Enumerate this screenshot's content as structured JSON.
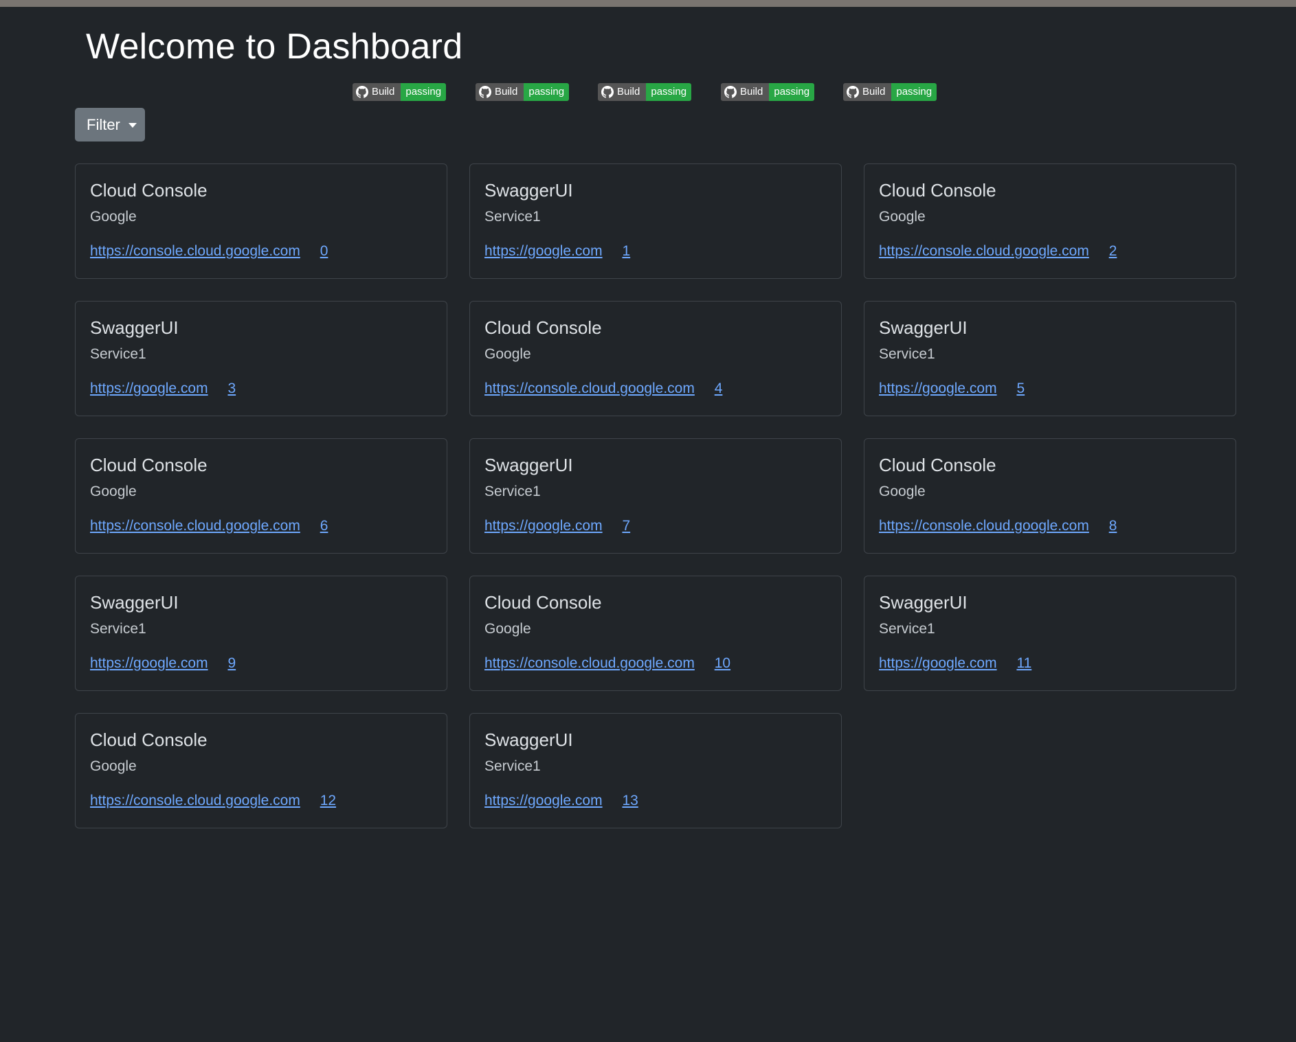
{
  "header": {
    "title": "Welcome to Dashboard"
  },
  "badges": [
    {
      "label": "Build",
      "status": "passing"
    },
    {
      "label": "Build",
      "status": "passing"
    },
    {
      "label": "Build",
      "status": "passing"
    },
    {
      "label": "Build",
      "status": "passing"
    },
    {
      "label": "Build",
      "status": "passing"
    }
  ],
  "filter": {
    "label": "Filter"
  },
  "cards": [
    {
      "title": "Cloud Console",
      "subtitle": "Google",
      "url": "https://console.cloud.google.com",
      "index": "0"
    },
    {
      "title": "SwaggerUI",
      "subtitle": "Service1",
      "url": "https://google.com",
      "index": "1"
    },
    {
      "title": "Cloud Console",
      "subtitle": "Google",
      "url": "https://console.cloud.google.com",
      "index": "2"
    },
    {
      "title": "SwaggerUI",
      "subtitle": "Service1",
      "url": "https://google.com",
      "index": "3"
    },
    {
      "title": "Cloud Console",
      "subtitle": "Google",
      "url": "https://console.cloud.google.com",
      "index": "4"
    },
    {
      "title": "SwaggerUI",
      "subtitle": "Service1",
      "url": "https://google.com",
      "index": "5"
    },
    {
      "title": "Cloud Console",
      "subtitle": "Google",
      "url": "https://console.cloud.google.com",
      "index": "6"
    },
    {
      "title": "SwaggerUI",
      "subtitle": "Service1",
      "url": "https://google.com",
      "index": "7"
    },
    {
      "title": "Cloud Console",
      "subtitle": "Google",
      "url": "https://console.cloud.google.com",
      "index": "8"
    },
    {
      "title": "SwaggerUI",
      "subtitle": "Service1",
      "url": "https://google.com",
      "index": "9"
    },
    {
      "title": "Cloud Console",
      "subtitle": "Google",
      "url": "https://console.cloud.google.com",
      "index": "10"
    },
    {
      "title": "SwaggerUI",
      "subtitle": "Service1",
      "url": "https://google.com",
      "index": "11"
    },
    {
      "title": "Cloud Console",
      "subtitle": "Google",
      "url": "https://console.cloud.google.com",
      "index": "12"
    },
    {
      "title": "SwaggerUI",
      "subtitle": "Service1",
      "url": "https://google.com",
      "index": "13"
    }
  ],
  "colors": {
    "background": "#212529",
    "link": "#6ea8fe",
    "badge_label_bg": "#555555",
    "badge_status_bg": "#28a745",
    "filter_button_bg": "#6c757d"
  },
  "icons": {
    "badge_icon": "github-icon",
    "filter_icon": "caret-down-icon"
  }
}
